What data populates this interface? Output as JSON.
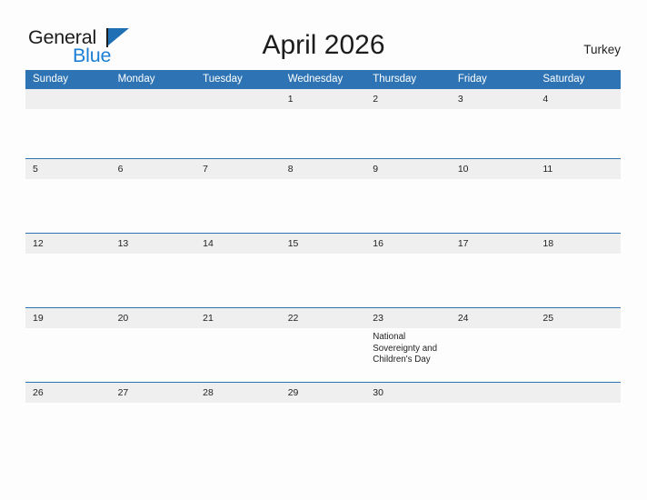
{
  "brand": {
    "name_part1": "General",
    "name_part2": "Blue",
    "flag_icon": "triangle-flag-icon",
    "color_dark": "#1c1c1c",
    "color_blue": "#1a7fd4",
    "flag_color": "#1f6fb5"
  },
  "header": {
    "title": "April 2026",
    "region": "Turkey"
  },
  "colors": {
    "header_blue": "#2e74b5",
    "date_band_gray": "#efefef",
    "page_background": "#fdfdfd",
    "text": "#1f1f1f"
  },
  "calendar": {
    "month": "April",
    "year": "2026",
    "weekday_headers": [
      "Sunday",
      "Monday",
      "Tuesday",
      "Wednesday",
      "Thursday",
      "Friday",
      "Saturday"
    ],
    "weeks": [
      {
        "days": [
          {
            "date": "",
            "event": ""
          },
          {
            "date": "",
            "event": ""
          },
          {
            "date": "",
            "event": ""
          },
          {
            "date": "1",
            "event": ""
          },
          {
            "date": "2",
            "event": ""
          },
          {
            "date": "3",
            "event": ""
          },
          {
            "date": "4",
            "event": ""
          }
        ]
      },
      {
        "days": [
          {
            "date": "5",
            "event": ""
          },
          {
            "date": "6",
            "event": ""
          },
          {
            "date": "7",
            "event": ""
          },
          {
            "date": "8",
            "event": ""
          },
          {
            "date": "9",
            "event": ""
          },
          {
            "date": "10",
            "event": ""
          },
          {
            "date": "11",
            "event": ""
          }
        ]
      },
      {
        "days": [
          {
            "date": "12",
            "event": ""
          },
          {
            "date": "13",
            "event": ""
          },
          {
            "date": "14",
            "event": ""
          },
          {
            "date": "15",
            "event": ""
          },
          {
            "date": "16",
            "event": ""
          },
          {
            "date": "17",
            "event": ""
          },
          {
            "date": "18",
            "event": ""
          }
        ]
      },
      {
        "days": [
          {
            "date": "19",
            "event": ""
          },
          {
            "date": "20",
            "event": ""
          },
          {
            "date": "21",
            "event": ""
          },
          {
            "date": "22",
            "event": ""
          },
          {
            "date": "23",
            "event": "National Sovereignty and Children's Day"
          },
          {
            "date": "24",
            "event": ""
          },
          {
            "date": "25",
            "event": ""
          }
        ]
      },
      {
        "days": [
          {
            "date": "26",
            "event": ""
          },
          {
            "date": "27",
            "event": ""
          },
          {
            "date": "28",
            "event": ""
          },
          {
            "date": "29",
            "event": ""
          },
          {
            "date": "30",
            "event": ""
          },
          {
            "date": "",
            "event": ""
          },
          {
            "date": "",
            "event": ""
          }
        ]
      }
    ]
  }
}
